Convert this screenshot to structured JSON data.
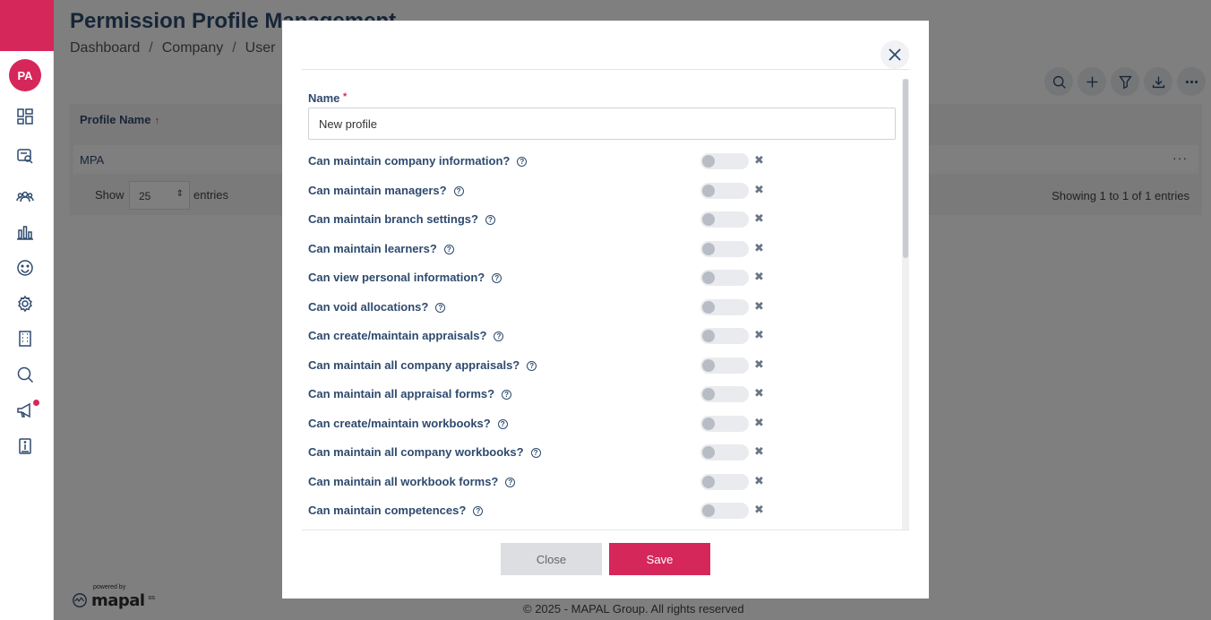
{
  "sidebar": {
    "avatar_initials": "PA",
    "icons": [
      "dashboard-icon",
      "report-search-icon",
      "users-icon",
      "chart-icon",
      "smiley-icon",
      "settings-icon",
      "building-icon",
      "search-icon",
      "megaphone-icon",
      "info-book-icon"
    ],
    "powered_by": "powered by",
    "brand": "mapal",
    "brand_suffix": "os"
  },
  "page": {
    "title": "Permission Profile Management",
    "breadcrumb": [
      "Dashboard",
      "Company",
      "User"
    ]
  },
  "table": {
    "column_header": "Profile Name",
    "sort_indicator": "↑",
    "rows": [
      {
        "name": "MPA"
      }
    ],
    "show_label": "Show",
    "page_size": "25",
    "entries_label": "entries",
    "showing": "Showing 1 to 1 of 1 entries"
  },
  "footer": "© 2025 - MAPAL Group. All rights reserved",
  "modal": {
    "name_label": "Name",
    "required_mark": "*",
    "name_value": "New profile",
    "permissions": [
      {
        "label": "Can maintain company information?",
        "enabled": false
      },
      {
        "label": "Can maintain managers?",
        "enabled": false
      },
      {
        "label": "Can maintain branch settings?",
        "enabled": false
      },
      {
        "label": "Can maintain learners?",
        "enabled": false
      },
      {
        "label": "Can view personal information?",
        "enabled": false
      },
      {
        "label": "Can void allocations?",
        "enabled": false
      },
      {
        "label": "Can create/maintain appraisals?",
        "enabled": false
      },
      {
        "label": "Can maintain all company appraisals?",
        "enabled": false
      },
      {
        "label": "Can maintain all appraisal forms?",
        "enabled": false
      },
      {
        "label": "Can create/maintain workbooks?",
        "enabled": false
      },
      {
        "label": "Can maintain all company workbooks?",
        "enabled": false
      },
      {
        "label": "Can maintain all workbook forms?",
        "enabled": false
      },
      {
        "label": "Can maintain competences?",
        "enabled": false
      }
    ],
    "help_glyph": "?",
    "off_glyph": "✖",
    "close_label": "Close",
    "save_label": "Save"
  },
  "colors": {
    "brand": "#d6275a",
    "text": "#2e4a6e"
  }
}
